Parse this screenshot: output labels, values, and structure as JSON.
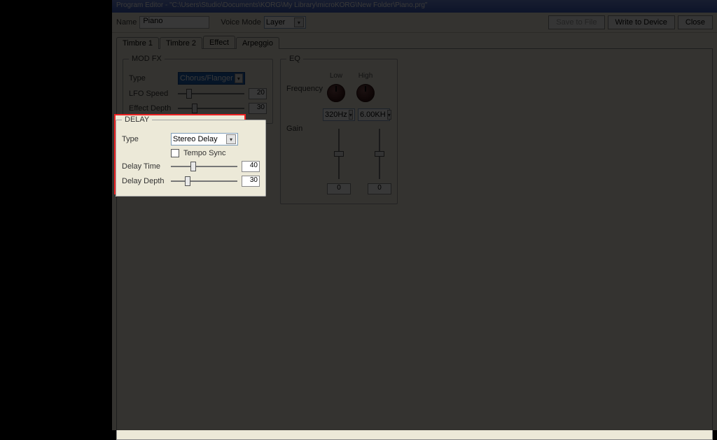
{
  "title": "Program Editor - \"C:\\Users\\Studio\\Documents\\KORG\\My Library\\microKORG\\New Folder\\Piano.prg\"",
  "name_label": "Name",
  "name_value": "Piano",
  "voice_mode_label": "Voice Mode",
  "voice_mode_value": "Layer",
  "buttons": {
    "save": "Save to File",
    "write": "Write to Device",
    "close": "Close"
  },
  "tabs": [
    "Timbre 1",
    "Timbre 2",
    "Effect",
    "Arpeggio"
  ],
  "modfx": {
    "legend": "MOD FX",
    "type_label": "Type",
    "type_value": "Chorus/Flanger",
    "lfo_label": "LFO Speed",
    "lfo_value": "20",
    "depth_label": "Effect Depth",
    "depth_value": "30"
  },
  "delay": {
    "legend": "DELAY",
    "type_label": "Type",
    "type_value": "Stereo Delay",
    "tempo_sync": "Tempo Sync",
    "time_label": "Delay Time",
    "time_value": "40",
    "depth_label": "Delay Depth",
    "depth_value": "30"
  },
  "eq": {
    "legend": "EQ",
    "freq_label": "Frequency",
    "low_label": "Low",
    "high_label": "High",
    "low_freq": "320Hz",
    "high_freq": "6.00KH",
    "gain_label": "Gain",
    "low_gain": "0",
    "high_gain": "0"
  }
}
